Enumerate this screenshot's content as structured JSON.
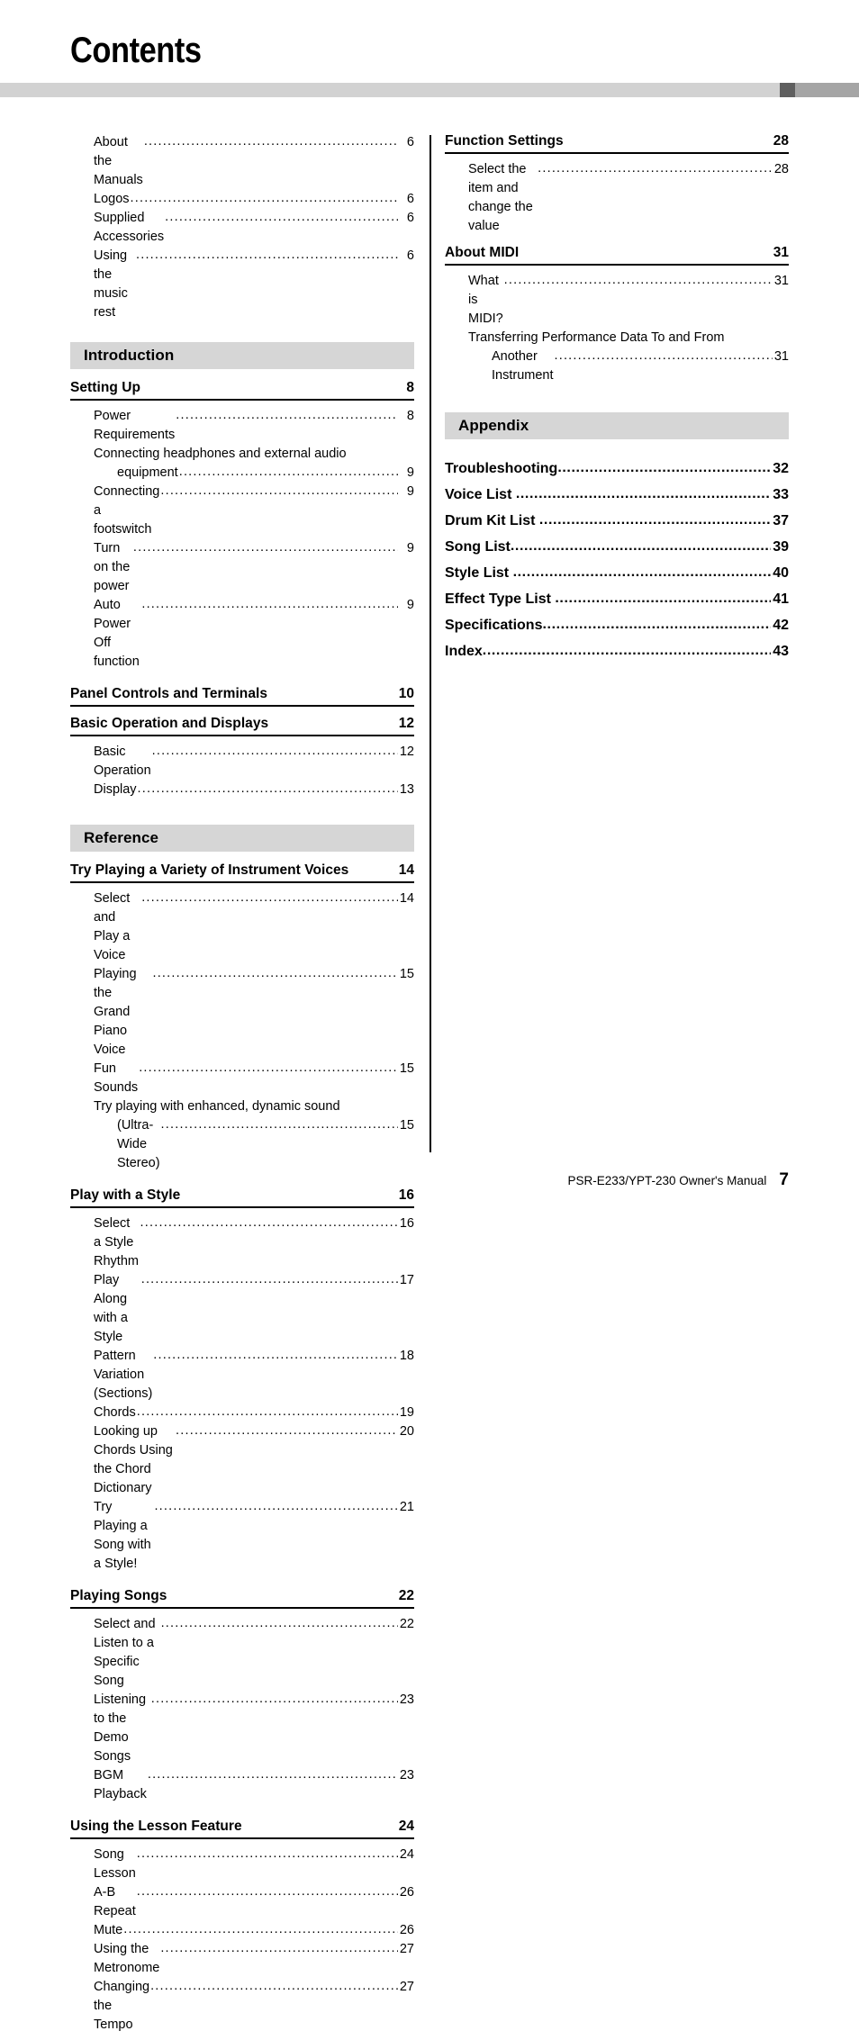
{
  "page_title": "Contents",
  "footer": {
    "manual_text": "PSR-E233/YPT-230  Owner's Manual",
    "page_number": "7"
  },
  "colors": {
    "band_gray": "#d6d6d6",
    "rule_light": "#d2d2d2",
    "rule_dark": "#5f5f5f",
    "rule_medium": "#a5a5a5"
  },
  "left_column": {
    "front_matter": [
      {
        "title": "About the Manuals",
        "page": "6"
      },
      {
        "title": "Logos",
        "page": "6"
      },
      {
        "title": "Supplied Accessories ",
        "page": "6"
      },
      {
        "title": "Using the music rest",
        "page": "6"
      }
    ],
    "sections": [
      {
        "band": "Introduction",
        "groups": [
          {
            "heading": "Setting Up",
            "heading_page": "8",
            "entries": [
              {
                "title": "Power Requirements",
                "page": "8"
              },
              {
                "wrap_first": "Connecting headphones and external audio",
                "title": "equipment",
                "page": "9",
                "continued": true
              },
              {
                "title": "Connecting a footswitch ",
                "page": "9"
              },
              {
                "title": "Turn on the power ",
                "page": "9"
              },
              {
                "title": "Auto Power Off function",
                "page": "9"
              }
            ]
          },
          {
            "heading": "Panel Controls and Terminals",
            "heading_page": "10",
            "entries": []
          },
          {
            "heading": "Basic Operation and Displays",
            "heading_page": "12",
            "entries": [
              {
                "title": "Basic Operation",
                "page": "12"
              },
              {
                "title": "Display",
                "page": "13"
              }
            ]
          }
        ]
      },
      {
        "band": "Reference",
        "groups": [
          {
            "heading": "Try Playing a Variety of Instrument Voices",
            "heading_page": "14",
            "entries": [
              {
                "title": "Select and Play a Voice",
                "page": "14"
              },
              {
                "title": "Playing the Grand Piano Voice",
                "page": "15"
              },
              {
                "title": "Fun Sounds ",
                "page": "15"
              },
              {
                "wrap_first": "Try playing with enhanced, dynamic sound",
                "title": "(Ultra-Wide Stereo)",
                "page": "15",
                "continued": true
              }
            ]
          },
          {
            "heading": "Play with a Style",
            "heading_page": "16",
            "entries": [
              {
                "title": "Select a Style Rhythm ",
                "page": "16"
              },
              {
                "title": "Play Along with a Style ",
                "page": "17"
              },
              {
                "title": "Pattern Variation (Sections)",
                "page": "18"
              },
              {
                "title": "Chords",
                "page": "19"
              },
              {
                "title": "Looking up Chords Using the Chord Dictionary ",
                "page": "20"
              },
              {
                "title": "Try Playing a Song with a Style!",
                "page": "21"
              }
            ]
          },
          {
            "heading": "Playing Songs",
            "heading_page": "22",
            "entries": [
              {
                "title": "Select and Listen to a Specific Song",
                "page": "22"
              },
              {
                "title": "Listening to the Demo Songs ",
                "page": "23"
              },
              {
                "title": "BGM Playback",
                "page": "23"
              }
            ]
          },
          {
            "heading": "Using the Lesson Feature",
            "heading_page": "24",
            "entries": [
              {
                "title": "Song Lesson",
                "page": "24"
              },
              {
                "title": "A-B Repeat ",
                "page": "26"
              },
              {
                "title": "Mute",
                "page": "26"
              },
              {
                "title": "Using the Metronome ",
                "page": "27"
              },
              {
                "title": "Changing the Tempo",
                "page": "27"
              }
            ]
          }
        ]
      }
    ]
  },
  "right_column": {
    "groups": [
      {
        "heading": "Function Settings",
        "heading_page": "28",
        "entries": [
          {
            "title": "Select the item and change the value ",
            "page": "28"
          }
        ]
      },
      {
        "heading": "About MIDI",
        "heading_page": "31",
        "entries": [
          {
            "title": "What is MIDI?",
            "page": "31"
          },
          {
            "wrap_first": "Transferring Performance Data To and From",
            "title": "Another Instrument",
            "page": "31",
            "continued": true
          }
        ]
      }
    ],
    "appendix": {
      "band": "Appendix",
      "entries": [
        {
          "title": "Troubleshooting",
          "page": "32"
        },
        {
          "title": "Voice List ",
          "page": "33"
        },
        {
          "title": "Drum Kit List ",
          "page": "37"
        },
        {
          "title": "Song List",
          "page": "39"
        },
        {
          "title": "Style List ",
          "page": "40"
        },
        {
          "title": "Effect Type List ",
          "page": "41"
        },
        {
          "title": "Specifications",
          "page": "42"
        },
        {
          "title": "Index",
          "page": "43"
        }
      ]
    }
  }
}
